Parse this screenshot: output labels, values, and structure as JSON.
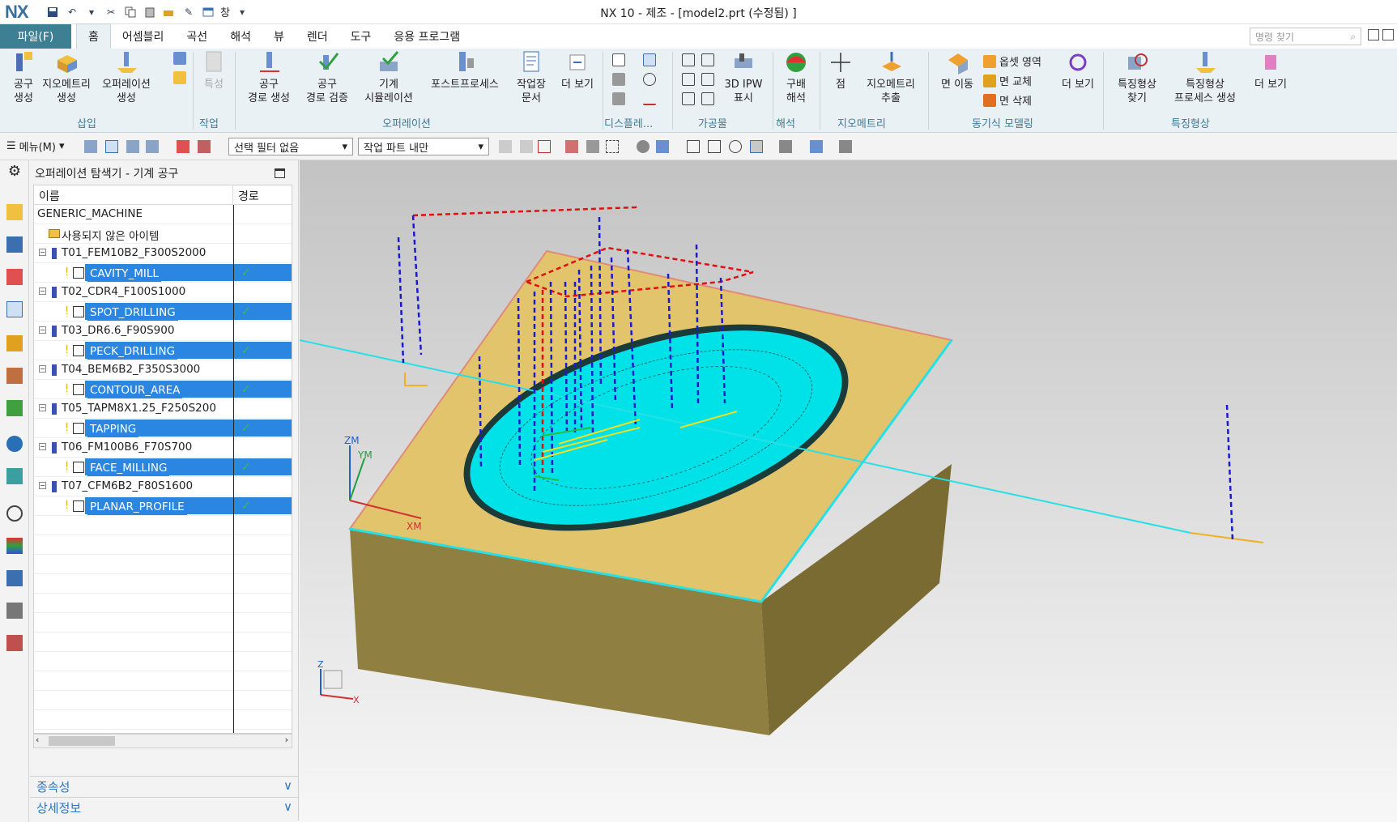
{
  "titlebar": {
    "logo": "NX",
    "window_menu": "창",
    "title": "NX 10 - 제조 - [model2.prt (수정됨) ]"
  },
  "ribbon_tabs": {
    "file": "파일(F)",
    "tabs": [
      "홈",
      "어셈블리",
      "곡선",
      "해석",
      "뷰",
      "렌더",
      "도구",
      "응용 프로그램"
    ],
    "active": "홈",
    "command_search_placeholder": "명령 찾기"
  },
  "ribbon": {
    "create_tool": "공구\n생성",
    "create_geometry": "지오메트리\n생성",
    "create_operation": "오퍼레이션\n생성",
    "group_insert": "삽입",
    "feature": "특성",
    "group_work": "작업",
    "generate_toolpath": "공구\n경로 생성",
    "verify_toolpath": "공구\n경로 검증",
    "machine_sim": "기계\n시뮬레이션",
    "postprocess": "포스트프로세스",
    "shop_doc": "작업장\n문서",
    "more1": "더 보기",
    "group_operation": "오퍼레이션",
    "group_display": "디스플레...",
    "ipw": "3D IPW\n표시",
    "group_workpiece": "가공물",
    "gouge": "구배\n해석",
    "group_analysis": "해석",
    "point": "점",
    "extract_geometry": "지오메트리\n추출",
    "group_geometry": "지오메트리",
    "move_face": "면 이동",
    "offset_region": "옵셋 영역",
    "replace_face": "면 교체",
    "delete_face": "면 삭제",
    "more2": "더 보기",
    "group_sync": "동기식 모델링",
    "find_feature": "특징형상\n찾기",
    "feature_process": "특징형상\n프로세스 생성",
    "more3": "더 보기",
    "group_feature": "특징형상"
  },
  "toolbar2": {
    "menu": "메뉴(M)",
    "selection_filter": "선택 필터 없음",
    "scope": "작업 파트 내만"
  },
  "navigator": {
    "title": "오퍼레이션 탐색기 - 기계 공구",
    "col_name": "이름",
    "col_path": "경로",
    "rows": [
      {
        "text": "GENERIC_MACHINE",
        "kind": "root",
        "indent": 0,
        "selected": false,
        "check": false
      },
      {
        "text": "사용되지 않은 아이템",
        "kind": "folder",
        "indent": 1,
        "selected": false,
        "check": false
      },
      {
        "text": "T01_FEM10B2_F300S2000",
        "kind": "tool",
        "indent": 1,
        "selected": false,
        "check": false
      },
      {
        "text": "CAVITY_MILL",
        "kind": "op",
        "indent": 2,
        "selected": true,
        "check": true
      },
      {
        "text": "T02_CDR4_F100S1000",
        "kind": "tool",
        "indent": 1,
        "selected": false,
        "check": false
      },
      {
        "text": "SPOT_DRILLING",
        "kind": "op",
        "indent": 2,
        "selected": true,
        "check": true
      },
      {
        "text": "T03_DR6.6_F90S900",
        "kind": "tool",
        "indent": 1,
        "selected": false,
        "check": false
      },
      {
        "text": "PECK_DRILLING",
        "kind": "op",
        "indent": 2,
        "selected": true,
        "check": true
      },
      {
        "text": "T04_BEM6B2_F350S3000",
        "kind": "tool",
        "indent": 1,
        "selected": false,
        "check": false
      },
      {
        "text": "CONTOUR_AREA",
        "kind": "op",
        "indent": 2,
        "selected": true,
        "check": true
      },
      {
        "text": "T05_TAPM8X1.25_F250S200",
        "kind": "tool",
        "indent": 1,
        "selected": false,
        "check": false
      },
      {
        "text": "TAPPING",
        "kind": "op",
        "indent": 2,
        "selected": true,
        "check": true
      },
      {
        "text": "T06_FM100B6_F70S700",
        "kind": "tool",
        "indent": 1,
        "selected": false,
        "check": false
      },
      {
        "text": "FACE_MILLING",
        "kind": "op",
        "indent": 2,
        "selected": true,
        "check": true
      },
      {
        "text": "T07_CFM6B2_F80S1600",
        "kind": "tool",
        "indent": 1,
        "selected": false,
        "check": false
      },
      {
        "text": "PLANAR_PROFILE",
        "kind": "op",
        "indent": 2,
        "selected": true,
        "check": true
      }
    ],
    "dependencies": "종속성",
    "details": "상세정보"
  },
  "viewport": {
    "zm": "ZM",
    "ym": "YM",
    "xm": "XM",
    "triad_z": "Z",
    "triad_x": "X"
  },
  "colors": {
    "accent": "#3d7f93",
    "selection": "#2a86e0",
    "block_top": "#e2c46d",
    "block_side": "#8a7a3f",
    "pocket": "#00e5ea",
    "rapid_red": "#e01010",
    "rapid_blue": "#1020d0"
  }
}
